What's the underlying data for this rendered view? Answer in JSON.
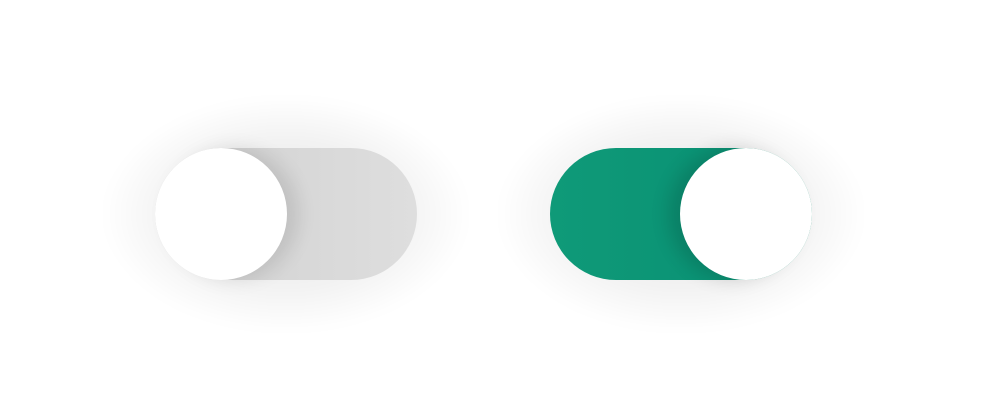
{
  "toggles": [
    {
      "state": "off",
      "track_color": "#dcdcdc",
      "knob_color": "#ffffff"
    },
    {
      "state": "on",
      "track_color": "#0b9375",
      "knob_color": "#ffffff"
    }
  ]
}
